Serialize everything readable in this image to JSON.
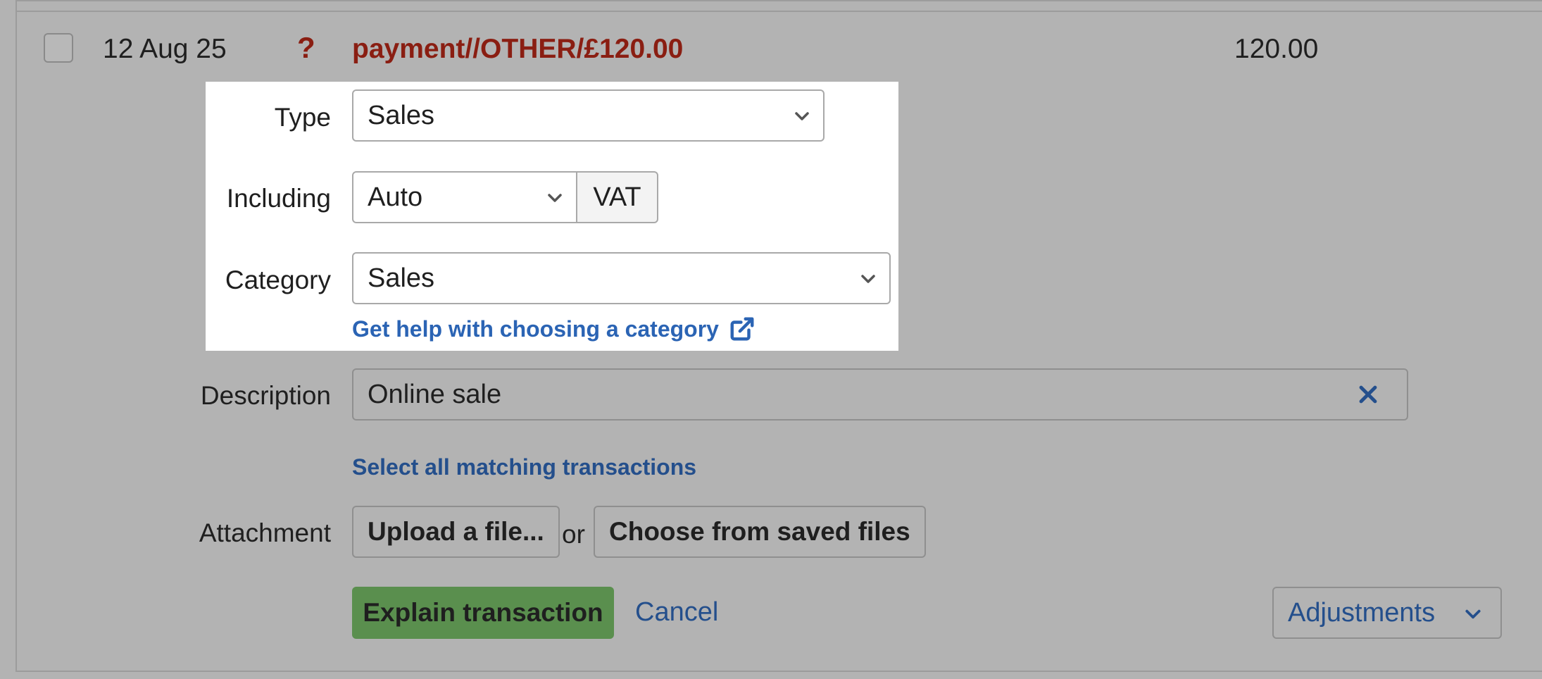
{
  "row": {
    "date": "12 Aug 25",
    "status_icon": "?",
    "description": "payment//OTHER/£120.00",
    "amount": "120.00"
  },
  "form": {
    "type": {
      "label": "Type",
      "value": "Sales"
    },
    "including": {
      "label": "Including",
      "value": "Auto",
      "suffix": "VAT"
    },
    "category": {
      "label": "Category",
      "value": "Sales",
      "help_link": "Get help with choosing a category"
    },
    "description": {
      "label": "Description",
      "value": "Online sale"
    },
    "select_matching": "Select all matching transactions",
    "attachment": {
      "label": "Attachment",
      "upload": "Upload a file...",
      "or": "or",
      "choose": "Choose from saved files"
    },
    "explain_button": "Explain transaction",
    "cancel": "Cancel",
    "adjustments": "Adjustments"
  },
  "colors": {
    "overlay": "#b3b3b3",
    "alert_red": "#8a1e12",
    "link_blue": "#2b64b4",
    "button_green": "#5a8f4e"
  }
}
